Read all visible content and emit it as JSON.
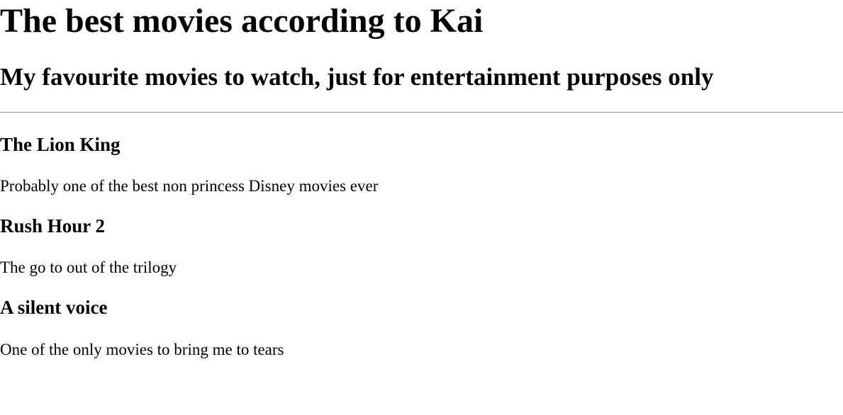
{
  "header": {
    "title": "The best movies according to Kai",
    "subtitle": "My favourite movies to watch, just for entertainment purposes only"
  },
  "movies": [
    {
      "title": "The Lion King",
      "description": "Probably one of the best non princess Disney movies ever"
    },
    {
      "title": "Rush Hour 2",
      "description": "The go to out of the trilogy"
    },
    {
      "title": "A silent voice",
      "description": "One of the only movies to bring me to tears"
    }
  ]
}
